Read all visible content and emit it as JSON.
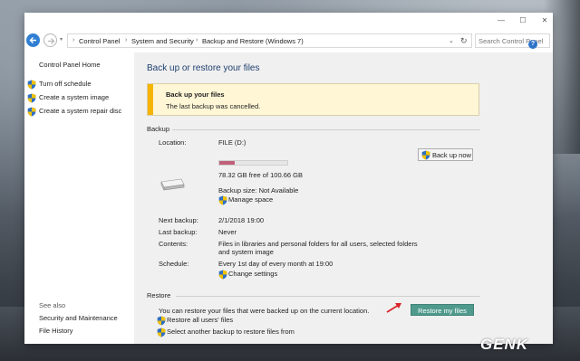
{
  "window": {
    "controls": {
      "minimize": "—",
      "maximize": "☐",
      "close": "✕"
    }
  },
  "address_bar": {
    "breadcrumbs": [
      "Control Panel",
      "System and Security",
      "Backup and Restore (Windows 7)"
    ],
    "search_placeholder": "Search Control Panel"
  },
  "sidebar": {
    "home_link": "Control Panel Home",
    "tasks": [
      "Turn off schedule",
      "Create a system image",
      "Create a system repair disc"
    ],
    "see_also_heading": "See also",
    "see_also": [
      "Security and Maintenance",
      "File History"
    ]
  },
  "main": {
    "title": "Back up or restore your files",
    "alert": {
      "title": "Back up your files",
      "message": "The last backup was cancelled."
    },
    "backup": {
      "section_label": "Backup",
      "location_label": "Location:",
      "location_value": "FILE (D:)",
      "usage_fraction": 0.22,
      "free_space": "78.32 GB free of 100.66 GB",
      "backup_size": "Backup size: Not Available",
      "manage_space": "Manage space",
      "back_up_now": "Back up now",
      "next_backup_label": "Next backup:",
      "next_backup_value": "2/1/2018 19:00",
      "last_backup_label": "Last backup:",
      "last_backup_value": "Never",
      "contents_label": "Contents:",
      "contents_value_line1": "Files in libraries and personal folders for all users, selected folders",
      "contents_value_line2": "and system image",
      "schedule_label": "Schedule:",
      "schedule_value": "Every 1st day of every month at 19:00",
      "change_settings": "Change settings"
    },
    "restore": {
      "section_label": "Restore",
      "description": "You can restore your files that were backed up on the current location.",
      "restore_my_files": "Restore my files",
      "restore_all_users": "Restore all users' files",
      "select_another": "Select another backup to restore files from"
    }
  },
  "watermark": {
    "logo_text": "GENK"
  },
  "colors": {
    "accent_button": "#4f9a8d",
    "alert_bar": "#f5b400",
    "usage_fill": "#c06078",
    "arrow": "#d9242a"
  }
}
